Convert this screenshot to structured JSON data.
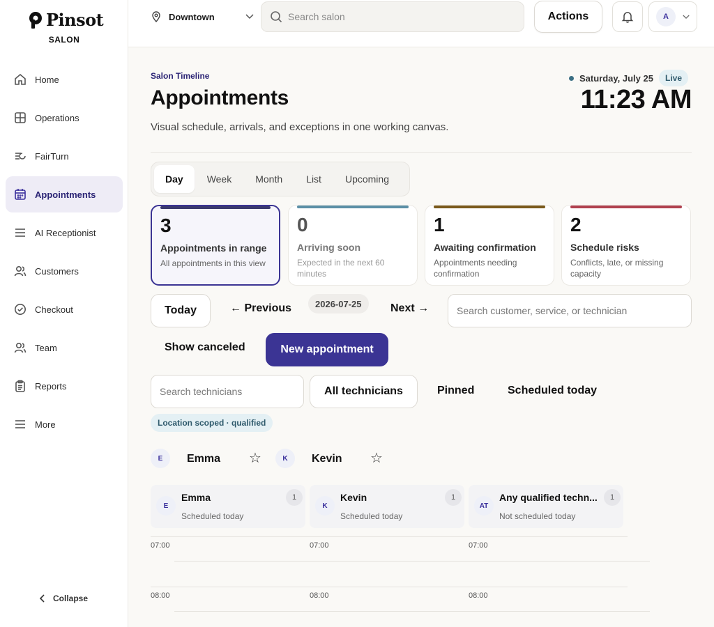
{
  "brand": {
    "name": "Pinsot",
    "sub": "SALON"
  },
  "sidebar": {
    "items": [
      {
        "label": "Home",
        "icon": "home-icon"
      },
      {
        "label": "Operations",
        "icon": "grid-icon"
      },
      {
        "label": "FairTurn",
        "icon": "turn-icon"
      },
      {
        "label": "Appointments",
        "icon": "calendar-icon",
        "active": true
      },
      {
        "label": "AI Receptionist",
        "icon": "menu-icon"
      },
      {
        "label": "Customers",
        "icon": "users-icon"
      },
      {
        "label": "Checkout",
        "icon": "check-circle-icon"
      },
      {
        "label": "Team",
        "icon": "team-icon"
      },
      {
        "label": "Reports",
        "icon": "clipboard-icon"
      },
      {
        "label": "More",
        "icon": "menu-icon"
      }
    ],
    "collapse_label": "Collapse"
  },
  "topbar": {
    "location": "Downtown",
    "search_placeholder": "Search salon",
    "actions_label": "Actions",
    "avatar_initial": "A"
  },
  "header": {
    "eyebrow": "Salon Timeline",
    "title": "Appointments",
    "subtitle": "Visual schedule, arrivals, and exceptions in one working canvas.",
    "date": "Saturday, July 25",
    "live_label": "Live",
    "time": "11:23 AM"
  },
  "tabs": [
    "Day",
    "Week",
    "Month",
    "List",
    "Upcoming"
  ],
  "stats": [
    {
      "value": "3",
      "label": "Appointments in range",
      "desc": "All appointments in this view",
      "color": "#3b3a6e"
    },
    {
      "value": "0",
      "label": "Arriving soon",
      "desc": "Expected in the next 60 minutes",
      "color": "#5b8fa6"
    },
    {
      "value": "1",
      "label": "Awaiting confirmation",
      "desc": "Appointments needing confirmation",
      "color": "#7a5a1c"
    },
    {
      "value": "2",
      "label": "Schedule risks",
      "desc": "Conflicts, late, or missing capacity",
      "color": "#b0414f"
    }
  ],
  "datenav": {
    "today_label": "Today",
    "prev_label": "← Previous",
    "date": "2026-07-25",
    "next_label": "Next →",
    "search_placeholder": "Search customer, service, or technician",
    "show_canceled_label": "Show canceled",
    "new_appointment_label": "New appointment"
  },
  "filters": {
    "tech_search_placeholder": "Search technicians",
    "all_label": "All technicians",
    "pinned_label": "Pinned",
    "scheduled_label": "Scheduled today",
    "scope_badge": "Location scoped · qualified"
  },
  "pinned_techs": [
    {
      "initial": "E",
      "name": "Emma"
    },
    {
      "initial": "K",
      "name": "Kevin"
    }
  ],
  "columns": [
    {
      "initial": "E",
      "name": "Emma",
      "status": "Scheduled today",
      "count": "1"
    },
    {
      "initial": "K",
      "name": "Kevin",
      "status": "Scheduled today",
      "count": "1"
    },
    {
      "initial": "AT",
      "name": "Any qualified techn...",
      "status": "Not scheduled today",
      "count": "1"
    }
  ],
  "times": [
    "07:00",
    "08:00"
  ],
  "colors": {
    "accent": "#3b3494",
    "live_bg": "#e4f0f4"
  }
}
